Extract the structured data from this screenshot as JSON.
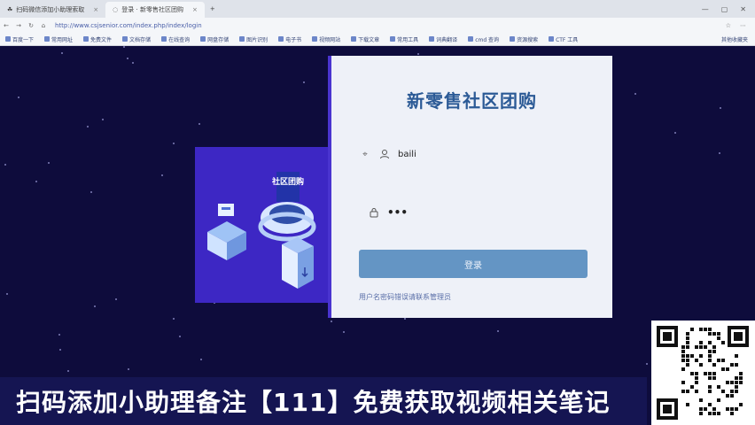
{
  "browser": {
    "tabs": [
      {
        "title": "扫码微信添加小助理索取",
        "active": false
      },
      {
        "title": "登录 · 新零售社区团购",
        "active": true
      }
    ],
    "url": "http://www.csjsenior.com/index.php/index/login"
  },
  "bookmarks": [
    "百度一下",
    "常用网址",
    "免费文件",
    "文档存储",
    "在线查询",
    "网盘存储",
    "图片识别",
    "电子书",
    "视频网站",
    "下载文章",
    "常用工具",
    "词典翻译",
    "cmd 查询",
    "资源搜索",
    "CTF 工具"
  ],
  "bookmark_right": "其他收藏夹",
  "login": {
    "title": "新零售社区团购",
    "username_value": "baili",
    "password_masked": "•••",
    "submit_label": "登录",
    "hint_text": "用户名密码错误请联系管理员"
  },
  "illustration": {
    "sign_text": "社区团购"
  },
  "banner": {
    "text": "扫码添加小助理备注【111】免费获取视频相关笔记"
  }
}
